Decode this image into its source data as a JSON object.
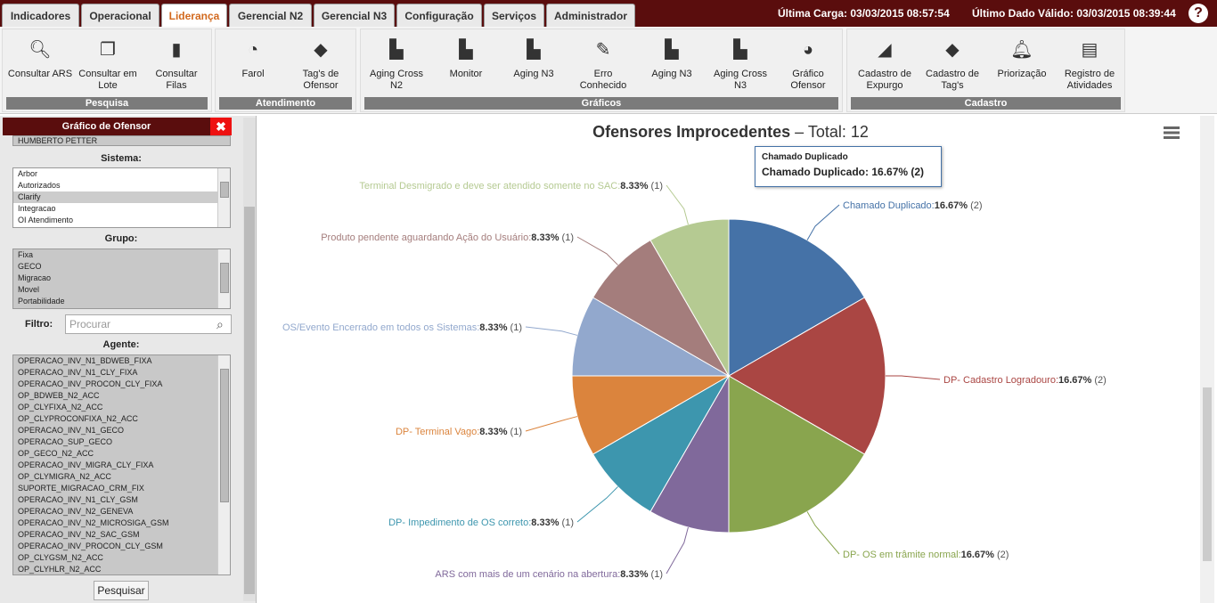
{
  "tabs": [
    "Indicadores",
    "Operacional",
    "Liderança",
    "Gerencial N2",
    "Gerencial N3",
    "Configuração",
    "Serviços",
    "Administrador"
  ],
  "status": {
    "carga": "Última Carga: 03/03/2015 08:57:54",
    "dado": "Último Dado Válido: 03/03/2015 08:39:44"
  },
  "help_icon": "?",
  "ribbon": {
    "pesquisa": {
      "title": "Pesquisa",
      "items": [
        "Consultar ARS",
        "Consultar em Lote",
        "Consultar Filas"
      ]
    },
    "atendimento": {
      "title": "Atendimento",
      "items": [
        "Farol",
        "Tag's de Ofensor"
      ]
    },
    "graficos": {
      "title": "Gráficos",
      "items": [
        "Aging Cross N2",
        "Monitor",
        "Aging N3",
        "Erro Conhecido",
        "Aging N3",
        "Aging Cross N3",
        "Gráfico Ofensor"
      ]
    },
    "cadastro": {
      "title": "Cadastro",
      "items": [
        "Cadastro de Expurgo",
        "Cadastro de Tag's",
        "Priorização",
        "Registro de Atividades"
      ]
    }
  },
  "left": {
    "title": "Gráfico de Ofensor",
    "close": "✖",
    "top_item": "HUMBERTO PETTER",
    "sistema_label": "Sistema:",
    "sistema": [
      "Arbor",
      "Autorizados",
      "Clarify",
      "Integracao",
      "OI Atendimento"
    ],
    "grupo_label": "Grupo:",
    "grupo": [
      "Fixa",
      "GECO",
      "Migracao",
      "Movel",
      "Portabilidade"
    ],
    "filtro_label": "Filtro:",
    "search_placeholder": "Procurar",
    "agente_label": "Agente:",
    "agente": [
      "OPERACAO_INV_N1_BDWEB_FIXA",
      "OPERACAO_INV_N1_CLY_FIXA",
      "OPERACAO_INV_PROCON_CLY_FIXA",
      "OP_BDWEB_N2_ACC",
      "OP_CLYFIXA_N2_ACC",
      "OP_CLYPROCONFIXA_N2_ACC",
      "OPERACAO_INV_N1_GECO",
      "OPERACAO_SUP_GECO",
      "OP_GECO_N2_ACC",
      "OPERACAO_INV_MIGRA_CLY_FIXA",
      "OP_CLYMIGRA_N2_ACC",
      "SUPORTE_MIGRACAO_CRM_FIX",
      "OPERACAO_INV_N1_CLY_GSM",
      "OPERACAO_INV_N2_GENEVA",
      "OPERACAO_INV_N2_MICROSIGA_GSM",
      "OPERACAO_INV_N2_SAC_GSM",
      "OPERACAO_INV_PROCON_CLY_GSM",
      "OP_CLYGSM_N2_ACC",
      "OP_CLYHLR_N2_ACC"
    ],
    "button": "Pesquisar"
  },
  "chart_title": {
    "main": "Ofensores Improcedentes",
    "sep": " – ",
    "total": "Total: 12"
  },
  "tooltip": {
    "title": "Chamado Duplicado",
    "body": "Chamado Duplicado: 16.67% (2)"
  },
  "chart_data": {
    "type": "pie",
    "title": "Ofensores Improcedentes – Total: 12",
    "slices": [
      {
        "name": "Chamado Duplicado",
        "value": 2,
        "pct": "16.67%",
        "color": "#4572a7"
      },
      {
        "name": "DP- Cadastro Logradouro",
        "value": 2,
        "pct": "16.67%",
        "color": "#aa4643"
      },
      {
        "name": "DP- OS em trâmite normal",
        "value": 2,
        "pct": "16.67%",
        "color": "#89a54e"
      },
      {
        "name": "ARS com mais de um cenário na abertura",
        "value": 1,
        "pct": "8.33%",
        "color": "#80699b"
      },
      {
        "name": "DP- Impedimento de OS correto",
        "value": 1,
        "pct": "8.33%",
        "color": "#3d96ae"
      },
      {
        "name": "DP- Terminal Vago",
        "value": 1,
        "pct": "8.33%",
        "color": "#db843d"
      },
      {
        "name": "OS/Evento Encerrado em todos os Sistemas",
        "value": 1,
        "pct": "8.33%",
        "color": "#92a8cd"
      },
      {
        "name": "Produto pendente aguardando Ação do Usuário",
        "value": 1,
        "pct": "8.33%",
        "color": "#a47d7c"
      },
      {
        "name": "Terminal Desmigrado e deve ser atendido somente no SAC",
        "value": 1,
        "pct": "8.33%",
        "color": "#b5ca92"
      }
    ]
  }
}
